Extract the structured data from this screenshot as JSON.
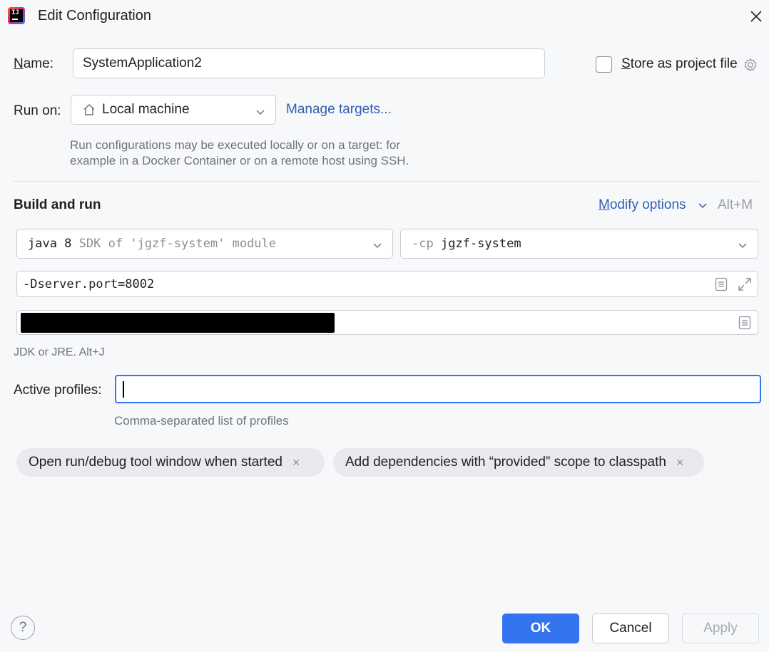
{
  "window": {
    "title": "Edit Configuration",
    "logo_text": "IJ",
    "close_icon": "close-icon"
  },
  "name": {
    "label_first": "N",
    "label_rest": "ame:",
    "value": "SystemApplication2"
  },
  "store": {
    "label_first": "S",
    "label_rest": "tore as project file",
    "checked": false
  },
  "run_on": {
    "label": "Run on:",
    "value": "Local machine",
    "manage_link": "Manage targets...",
    "hint_line1": "Run configurations may be executed locally or on a target: for",
    "hint_line2": "example in a Docker Container or on a remote host using SSH."
  },
  "build": {
    "title": "Build and run",
    "modify_first": "M",
    "modify_rest": "odify options",
    "modify_shortcut": "Alt+M",
    "sdk_value": "java 8",
    "sdk_detail": "SDK of 'jgzf-system' module",
    "cp_prefix": "-cp",
    "cp_value": "jgzf-system",
    "vm_options": "-Dserver.port=8002",
    "jdk_hint": "JDK or JRE. Alt+J"
  },
  "profiles": {
    "label": "Active profiles:",
    "value": "",
    "hint": "Comma-separated list of profiles"
  },
  "chips": [
    {
      "label": "Open run/debug tool window when started"
    },
    {
      "label": "Add dependencies with “provided” scope to classpath"
    }
  ],
  "chip_remove": "×",
  "footer": {
    "help": "?",
    "ok": "OK",
    "cancel": "Cancel",
    "apply": "Apply"
  },
  "colors": {
    "accent": "#3574f0",
    "link": "#2f5fb3",
    "background": "#f7f8fa"
  }
}
